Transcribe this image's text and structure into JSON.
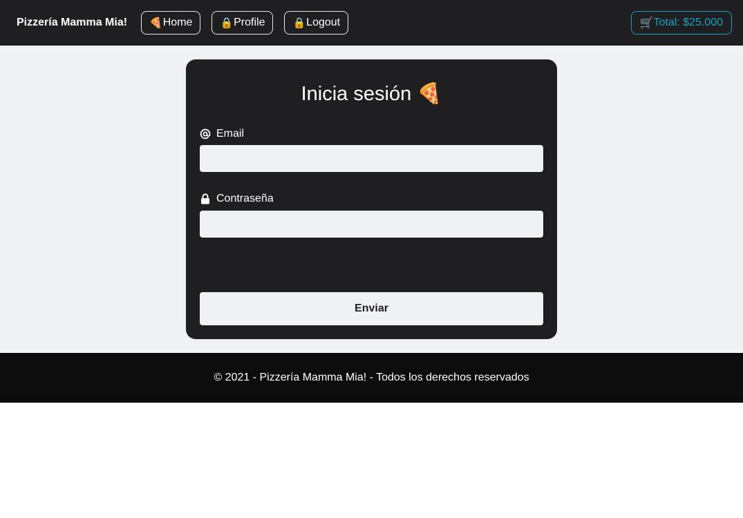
{
  "navbar": {
    "brand": "Pizzería Mamma Mia!",
    "links": [
      {
        "icon": "🍕",
        "label": "Home"
      },
      {
        "icon": "🔒",
        "label": "Profile"
      },
      {
        "icon": "🔒",
        "label": "Logout"
      }
    ],
    "cart": {
      "icon": "🛒",
      "label": "Total: $25.000"
    }
  },
  "login": {
    "title": "Inicia sesión 🍕",
    "email_label": "Email",
    "email_value": "",
    "password_label": "Contraseña",
    "password_value": "",
    "submit_label": "Enviar"
  },
  "footer": {
    "text": "© 2021 - Pizzería Mamma Mia! - Todos los derechos reservados"
  },
  "colors": {
    "navbar_bg": "#1f1f21",
    "page_bg": "#f0f1f5",
    "card_bg": "#1f1f21",
    "footer_bg": "#0d0d0d",
    "cart_accent": "#17a2c2"
  },
  "icons": {
    "email": "at-icon",
    "password": "lock-icon"
  }
}
